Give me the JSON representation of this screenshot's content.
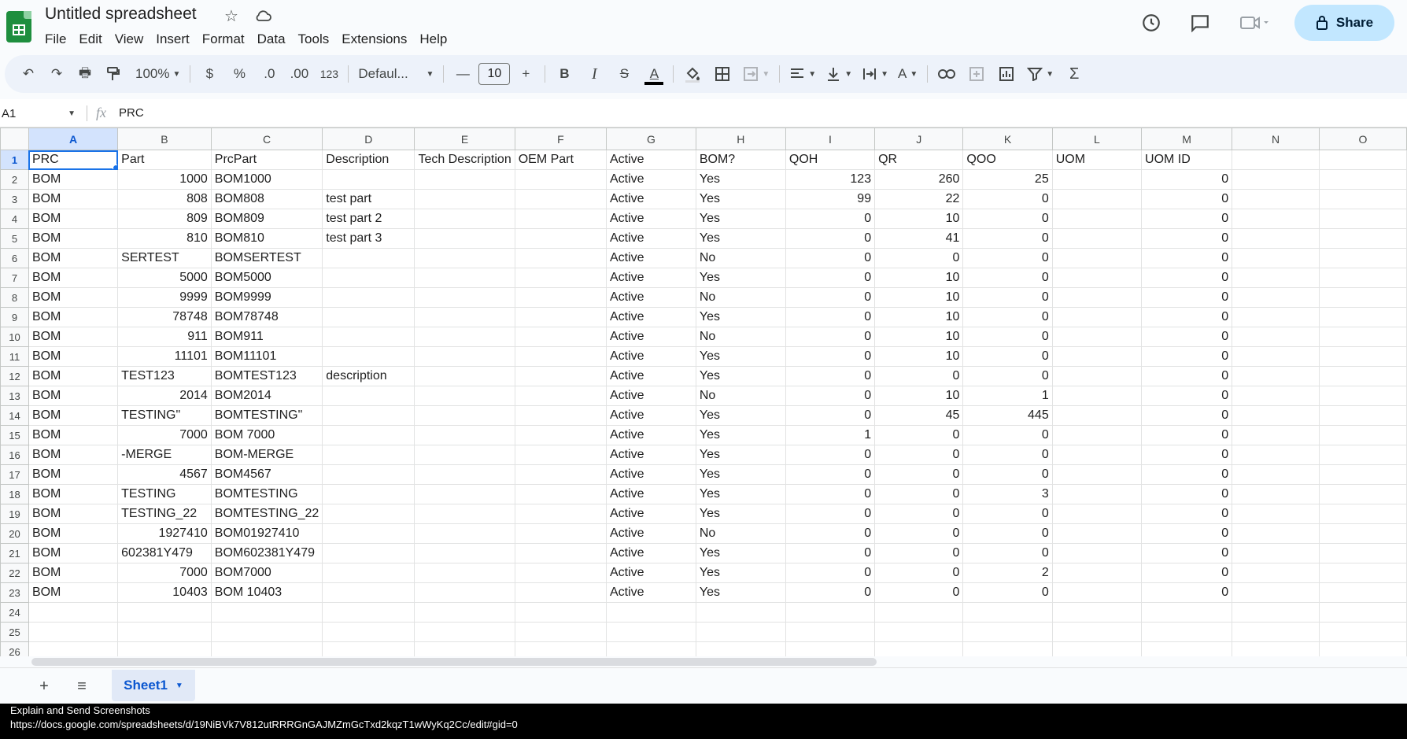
{
  "app": {
    "title": "Untitled spreadsheet",
    "menu": [
      "File",
      "Edit",
      "View",
      "Insert",
      "Format",
      "Data",
      "Tools",
      "Extensions",
      "Help"
    ],
    "share_label": "Share"
  },
  "toolbar": {
    "zoom": "100%",
    "currency": "$",
    "percent": "%",
    "dec_decrease": ".0",
    "dec_increase": ".00",
    "number_format": "123",
    "font": "Defaul...",
    "font_size": "10",
    "bold": "B",
    "italic": "I",
    "strike": "S",
    "text_color": "A",
    "text_rotate": "A",
    "functions": "Σ"
  },
  "formula_bar": {
    "cell_ref": "A1",
    "fx": "fx",
    "content": "PRC"
  },
  "grid": {
    "columns": [
      "A",
      "B",
      "C",
      "D",
      "E",
      "F",
      "G",
      "H",
      "I",
      "J",
      "K",
      "L",
      "M",
      "N",
      "O"
    ],
    "rows": [
      [
        "PRC",
        "Part",
        "PrcPart",
        "Description",
        "Tech Description",
        "OEM Part",
        "Active",
        "BOM?",
        "QOH",
        "QR",
        "QOO",
        "UOM",
        "UOM ID"
      ],
      [
        "BOM",
        "1000",
        "BOM1000",
        "",
        "",
        "",
        "Active",
        "Yes",
        "123",
        "260",
        "25",
        "",
        "0"
      ],
      [
        "BOM",
        "808",
        "BOM808",
        "test part",
        "",
        "",
        "Active",
        "Yes",
        "99",
        "22",
        "0",
        "",
        "0"
      ],
      [
        "BOM",
        "809",
        "BOM809",
        "test part 2",
        "",
        "",
        "Active",
        "Yes",
        "0",
        "10",
        "0",
        "",
        "0"
      ],
      [
        "BOM",
        "810",
        "BOM810",
        "test part 3",
        "",
        "",
        "Active",
        "Yes",
        "0",
        "41",
        "0",
        "",
        "0"
      ],
      [
        "BOM",
        "SERTEST",
        "BOMSERTEST",
        "",
        "",
        "",
        "Active",
        "No",
        "0",
        "0",
        "0",
        "",
        "0"
      ],
      [
        "BOM",
        "5000",
        "BOM5000",
        "",
        "",
        "",
        "Active",
        "Yes",
        "0",
        "10",
        "0",
        "",
        "0"
      ],
      [
        "BOM",
        "9999",
        "BOM9999",
        "",
        "",
        "",
        "Active",
        "No",
        "0",
        "10",
        "0",
        "",
        "0"
      ],
      [
        "BOM",
        "78748",
        "BOM78748",
        "",
        "",
        "",
        "Active",
        "Yes",
        "0",
        "10",
        "0",
        "",
        "0"
      ],
      [
        "BOM",
        "911",
        "BOM911",
        "",
        "",
        "",
        "Active",
        "No",
        "0",
        "10",
        "0",
        "",
        "0"
      ],
      [
        "BOM",
        "11101",
        "BOM11101",
        "",
        "",
        "",
        "Active",
        "Yes",
        "0",
        "10",
        "0",
        "",
        "0"
      ],
      [
        "BOM",
        "TEST123",
        "BOMTEST123",
        "description",
        "",
        "",
        "Active",
        "Yes",
        "0",
        "0",
        "0",
        "",
        "0"
      ],
      [
        "BOM",
        "2014",
        "BOM2014",
        "",
        "",
        "",
        "Active",
        "No",
        "0",
        "10",
        "1",
        "",
        "0"
      ],
      [
        "BOM",
        "TESTING\"",
        "BOMTESTING\"",
        "",
        "",
        "",
        "Active",
        "Yes",
        "0",
        "45",
        "445",
        "",
        "0"
      ],
      [
        "BOM",
        "7000",
        "BOM 7000",
        "",
        "",
        "",
        "Active",
        "Yes",
        "1",
        "0",
        "0",
        "",
        "0"
      ],
      [
        "BOM",
        "-MERGE",
        "BOM-MERGE",
        "",
        "",
        "",
        "Active",
        "Yes",
        "0",
        "0",
        "0",
        "",
        "0"
      ],
      [
        "BOM",
        "4567",
        "BOM4567",
        "",
        "",
        "",
        "Active",
        "Yes",
        "0",
        "0",
        "0",
        "",
        "0"
      ],
      [
        "BOM",
        "TESTING",
        "BOMTESTING",
        "",
        "",
        "",
        "Active",
        "Yes",
        "0",
        "0",
        "3",
        "",
        "0"
      ],
      [
        "BOM",
        "TESTING_22",
        "BOMTESTING_22",
        "",
        "",
        "",
        "Active",
        "Yes",
        "0",
        "0",
        "0",
        "",
        "0"
      ],
      [
        "BOM",
        "1927410",
        "BOM01927410",
        "",
        "",
        "",
        "Active",
        "No",
        "0",
        "0",
        "0",
        "",
        "0"
      ],
      [
        "BOM",
        "602381Y479",
        "BOM602381Y479",
        "",
        "",
        "",
        "Active",
        "Yes",
        "0",
        "0",
        "0",
        "",
        "0"
      ],
      [
        "BOM",
        "7000",
        "BOM7000",
        "",
        "",
        "",
        "Active",
        "Yes",
        "0",
        "0",
        "2",
        "",
        "0"
      ],
      [
        "BOM",
        "10403",
        "BOM 10403",
        "",
        "",
        "",
        "Active",
        "Yes",
        "0",
        "0",
        "0",
        "",
        "0"
      ]
    ],
    "total_rows": 26
  },
  "sheets": {
    "tabs": [
      "Sheet1"
    ]
  },
  "status": {
    "line1": "Explain and Send Screenshots",
    "line2": "https://docs.google.com/spreadsheets/d/19NiBVk7V812utRRRGnGAJMZmGcTxd2kqzT1wWyKq2Cc/edit#gid=0"
  },
  "colors": {
    "accent": "#0b57d0",
    "share_bg": "#c2e7ff",
    "logo": "#1e8e3e",
    "selection": "#1a73e8"
  }
}
